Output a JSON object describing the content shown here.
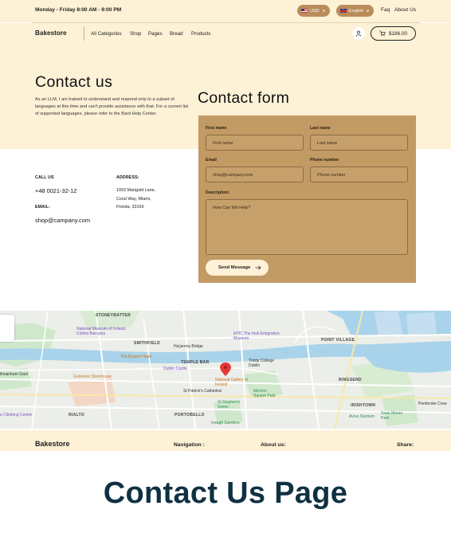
{
  "topbar": {
    "hours": "Monday - Friday  8:00 AM - 9:00 PM",
    "currency": "USD",
    "language": "English",
    "links": [
      "Faq",
      "About Us"
    ]
  },
  "nav": {
    "brand": "Bakestore",
    "links": [
      "All Categories",
      "Shop",
      "Pages",
      "Bread",
      "Products"
    ],
    "cart_total": "$186.00",
    "user_icon": "user-icon",
    "cart_icon": "cart-icon"
  },
  "hero": {
    "title": "Contact us",
    "description": "As an LLM, I am trained to understand and respond only to a subset of languages at this time and can't provide assistance with that. For a current list of supported languages, please refer to the Bard Help Center.",
    "form_title": "Contact form"
  },
  "contact": {
    "call_label": "CALL US",
    "phone": "+48 0021-32-12",
    "email_label": "EMAIL:",
    "email": "shop@campany.com",
    "address_label": "ADDRESS:",
    "address_lines": [
      "1093 Marigold Lane,",
      "Coral Way, Miami,",
      "Florida, 33169"
    ]
  },
  "form": {
    "first_name_label": "First name",
    "first_name_placeholder": "First name",
    "last_name_label": "Last name",
    "last_name_placeholder": "Last name",
    "email_label": "Email",
    "email_placeholder": "shop@campany.com",
    "phone_label": "Phone number",
    "phone_placeholder": "Phone number",
    "description_label": "Description:",
    "description_placeholder": "How Can We Help?",
    "send_label": "Send Message"
  },
  "map": {
    "labels": {
      "stoneybatter": "STONEYBATTER",
      "smithfield": "SMITHFIELD",
      "temple_bar": "TEMPLE BAR",
      "point_village": "POINT VILLAGE",
      "ringsend": "RINGSEND",
      "irishtown": "IRISHTOWN",
      "portobello": "PORTOBELLO",
      "rialto": "RIALTO",
      "museum": "National Museum of Ireland, Collins Barracks",
      "epic": "EPIC The Irish Emigration Museum",
      "brazen_head": "The Brazen Head",
      "guinness": "Guinness Storehouse",
      "dublin_castle": "Dublin Castle",
      "trinity": "Trinity College Dublin",
      "gallery": "National Gallery of Ireland",
      "st_patricks": "St Patrick's Cathedral",
      "merrion": "Merrion Square Park",
      "stephens": "St Stephen's Green",
      "ha_penny": "Ha'penny Bridge",
      "aviva": "Aviva Stadium",
      "pembroke": "Pembroke Cove",
      "kilmainham": "ilmainham Gaol",
      "climbing": "e Climbing Centre",
      "seanmoore": "Sean Moore Park",
      "iveagh": "Iveagh Gardens"
    }
  },
  "footer": {
    "brand": "Bakestore",
    "navigation": "Navigation :",
    "about": "About us:",
    "share": "Share:"
  },
  "caption": "Contact Us Page"
}
